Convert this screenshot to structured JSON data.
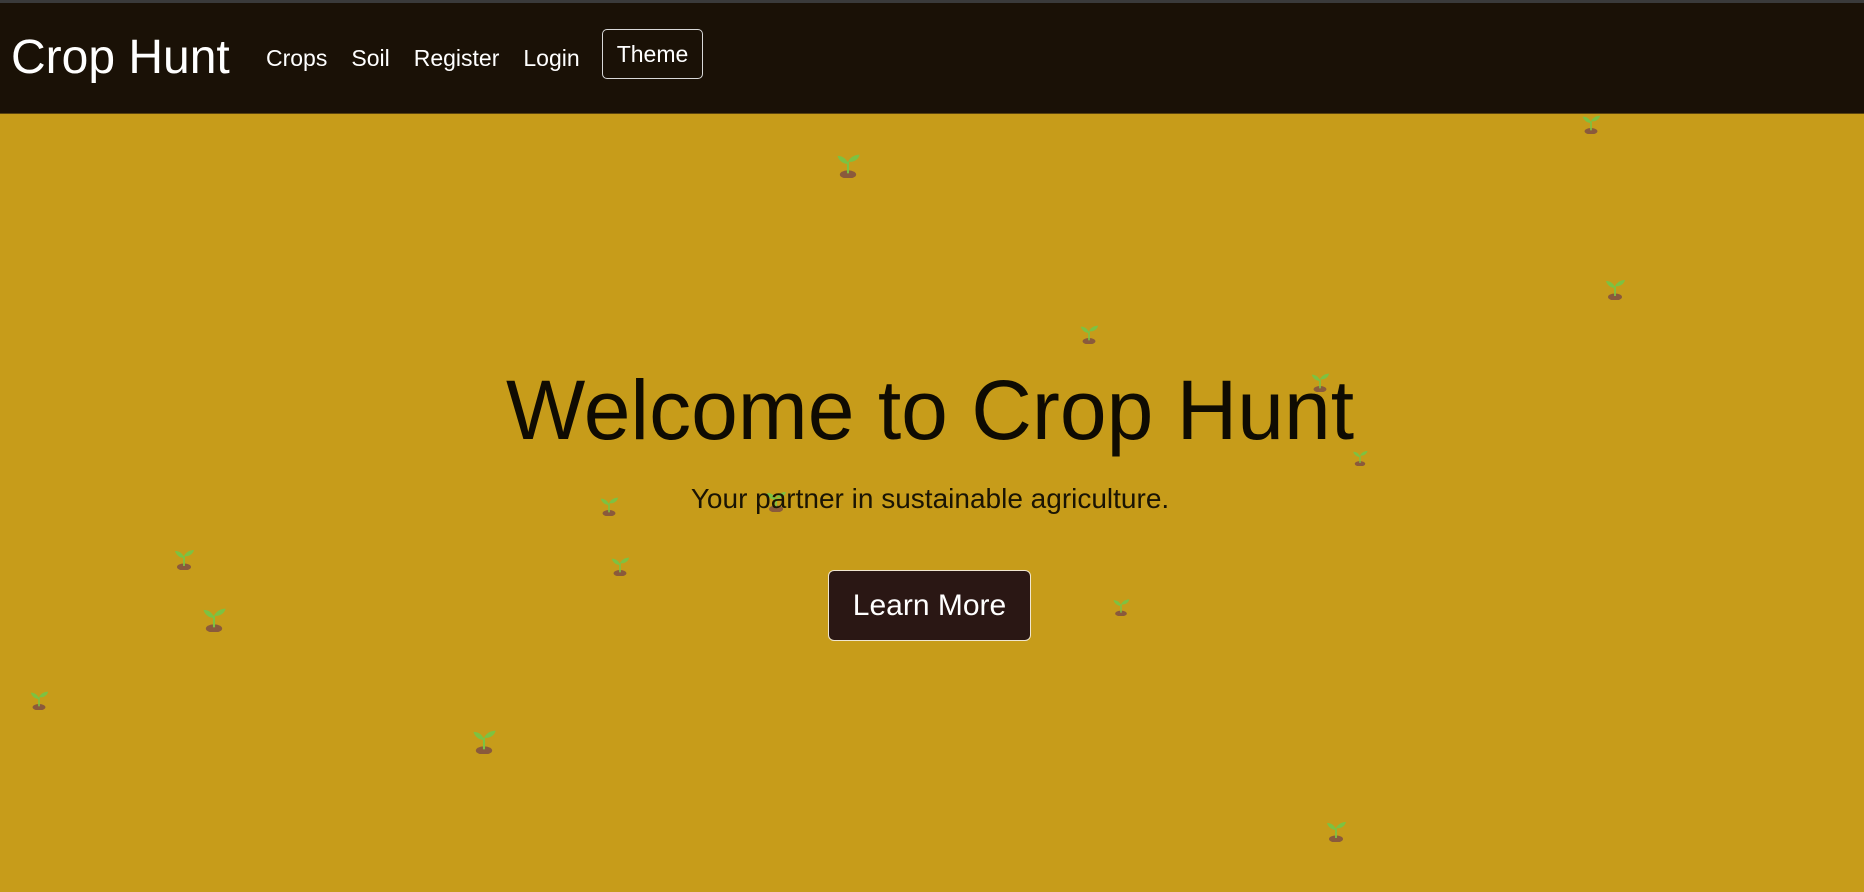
{
  "header": {
    "brand": "Crop Hunt",
    "nav": [
      "Crops",
      "Soil",
      "Register",
      "Login"
    ],
    "theme_button": "Theme"
  },
  "hero": {
    "title": "Welcome to Crop Hunt",
    "subtitle": "Your partner in sustainable agriculture.",
    "cta_label": "Learn More"
  },
  "decorations": {
    "icon": "sprout-icon",
    "count": 20
  },
  "colors": {
    "page_background": "#c79c1a",
    "navbar_background": "#1a1106",
    "cta_background": "#2a1714",
    "sprout_leaf": "#7cc242",
    "sprout_soil": "#8a5a3c"
  }
}
